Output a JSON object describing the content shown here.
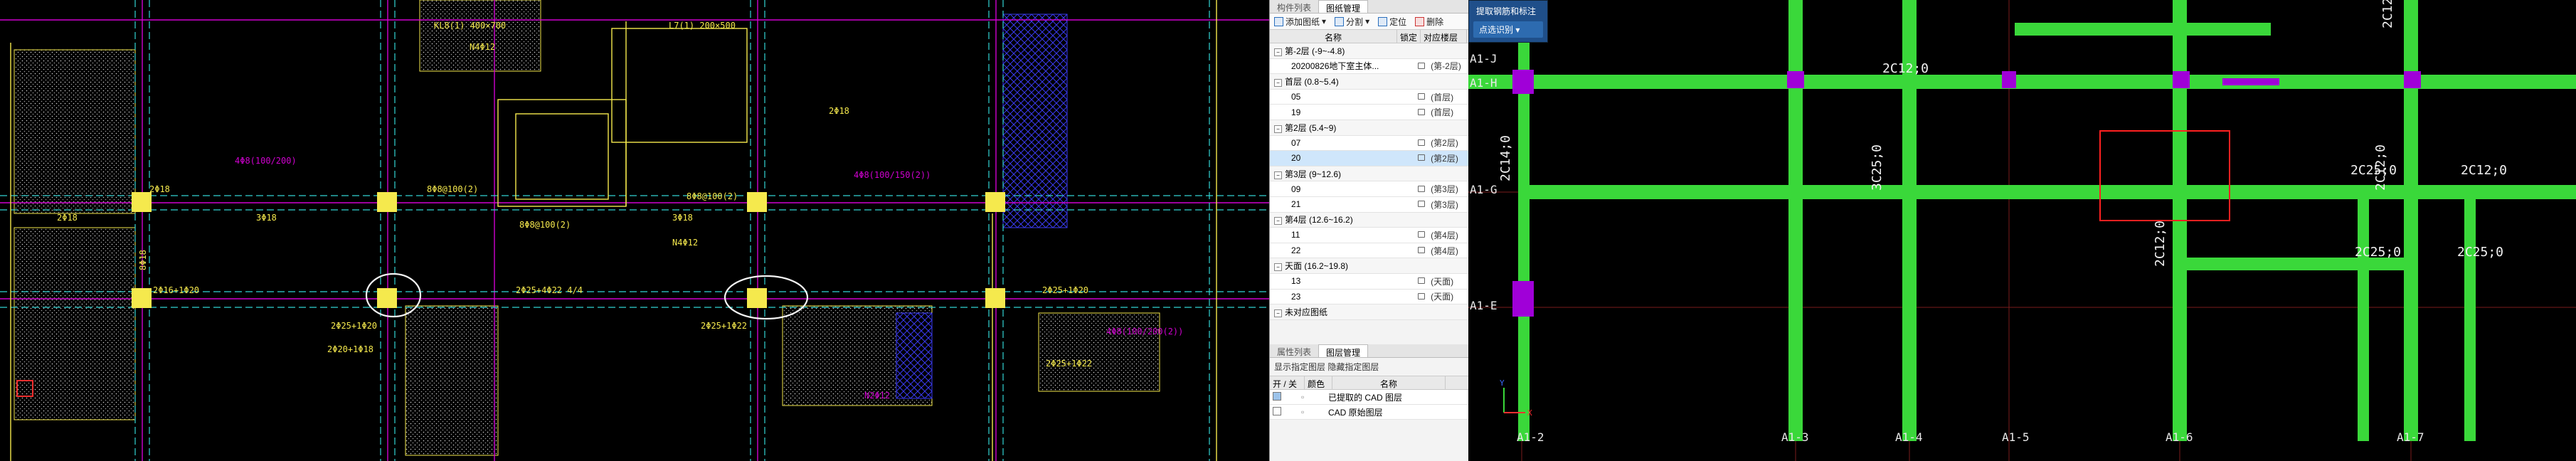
{
  "panel": {
    "tabs": [
      "构件列表",
      "图纸管理"
    ],
    "toolbar": [
      "添加图纸",
      "分割",
      "定位",
      "删除"
    ],
    "columns": {
      "name": "名称",
      "lock": "锁定",
      "floor": "对应楼层"
    },
    "rows": [
      {
        "name": "第-2层 (-9~-4.8)",
        "group": true
      },
      {
        "name": "20200826地下室主体...",
        "floor": "(第-2层)"
      },
      {
        "name": "首层 (0.8~5.4)",
        "group": true
      },
      {
        "name": "05",
        "floor": "(首层)"
      },
      {
        "name": "19",
        "floor": "(首层)"
      },
      {
        "name": "第2层 (5.4~9)",
        "group": true
      },
      {
        "name": "07",
        "floor": "(第2层)"
      },
      {
        "name": "20",
        "floor": "(第2层)",
        "selected": true
      },
      {
        "name": "第3层 (9~12.6)",
        "group": true
      },
      {
        "name": "09",
        "floor": "(第3层)"
      },
      {
        "name": "21",
        "floor": "(第3层)"
      },
      {
        "name": "第4层 (12.6~16.2)",
        "group": true
      },
      {
        "name": "11",
        "floor": "(第4层)"
      },
      {
        "name": "22",
        "floor": "(第4层)"
      },
      {
        "name": "天面 (16.2~19.8)",
        "group": true
      },
      {
        "name": "13",
        "floor": "(天面)"
      },
      {
        "name": "23",
        "floor": "(天面)"
      },
      {
        "name": "未对应图纸",
        "group": true
      }
    ],
    "tabs2": [
      "属性列表",
      "图层管理"
    ],
    "layer_hint": "显示指定图层   隐藏指定图层",
    "layer_cols": {
      "onoff": "开 / 关",
      "color": "颜色",
      "name": "名称"
    },
    "layers": [
      {
        "name": "已提取的 CAD 图层",
        "checked": true
      },
      {
        "name": "CAD 原始图层",
        "checked": false
      }
    ]
  },
  "popup": {
    "title": "提取钢筋和标注",
    "dropdown": "点选识别"
  },
  "cad_right": {
    "axes_bottom": [
      "A1-2",
      "A1-3",
      "A1-4",
      "A1-5",
      "A1-6",
      "A1-7"
    ],
    "axes_left": [
      "A1-J",
      "A1-H",
      "A1-G",
      "A1-E"
    ],
    "labels": [
      "2C12;0",
      "2C14;0",
      "3C25;0",
      "2C12;0",
      "2C25;0",
      "2C12;0",
      "2C25;0",
      "2C12;0",
      "2C25;0",
      "2C12;0"
    ]
  },
  "cad_left": {
    "labels": [
      "4Φ8(100/200)",
      "2Φ18",
      "8Φ18",
      "2Φ18",
      "3Φ18",
      "2Φ16+1Φ20",
      "2Φ25+1Φ20",
      "2Φ25+1Φ22",
      "N2Φ12",
      "2Φ18",
      "8Φ8@100(2)",
      "3Φ18",
      "N4Φ12",
      "4Φ8(100/150(2))",
      "2Φ25+4Φ22 4/4",
      "2Φ20+1Φ18",
      "KL8(1) 400×700",
      "L7(1) 200×500",
      "8Φ8@100(2)",
      "N4Φ12",
      "8Φ8@100(2)",
      "2Φ25+1Φ20",
      "2Φ25+1Φ22",
      "4Φ8(100/200(2))"
    ]
  }
}
